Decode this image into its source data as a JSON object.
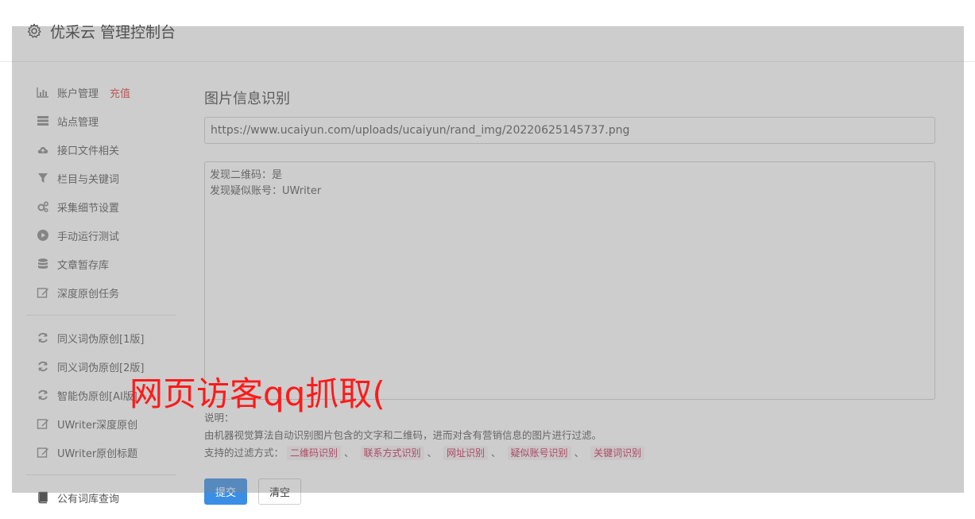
{
  "header": {
    "title": "优采云 管理控制台"
  },
  "sidebar": {
    "items": [
      {
        "label": "账户管理",
        "extra": "充值",
        "icon": "bar-chart-icon"
      },
      {
        "label": "站点管理",
        "icon": "server-icon"
      },
      {
        "label": "接口文件相关",
        "icon": "cloud-upload-icon"
      },
      {
        "label": "栏目与关键词",
        "icon": "filter-icon"
      },
      {
        "label": "采集细节设置",
        "icon": "gears-icon"
      },
      {
        "label": "手动运行测试",
        "icon": "play-circle-icon"
      },
      {
        "label": "文章暂存库",
        "icon": "database-icon"
      },
      {
        "label": "深度原创任务",
        "icon": "edit-icon"
      },
      {
        "label": "同义词伪原创[1版]",
        "icon": "refresh-icon"
      },
      {
        "label": "同义词伪原创[2版]",
        "icon": "refresh-icon"
      },
      {
        "label": "智能伪原创[AI版]",
        "icon": "refresh-icon"
      },
      {
        "label": "UWriter深度原创",
        "icon": "edit-icon"
      },
      {
        "label": "UWriter原创标题",
        "icon": "edit-icon"
      },
      {
        "label": "公有词库查询",
        "icon": "book-icon"
      }
    ]
  },
  "main": {
    "section_title": "图片信息识别",
    "url_value": "https://www.ucaiyun.com/uploads/ucaiyun/rand_img/20220625145737.png",
    "result_lines": [
      "发现二维码：是",
      "发现疑似账号：UWriter"
    ],
    "notes_heading": "说明：",
    "notes_desc": "由机器视觉算法自动识别图片包含的文字和二维码，进而对含有营销信息的图片进行过滤。",
    "filter_label": "支持的过滤方式：",
    "filter_tags": [
      "二维码识别",
      "联系方式识别",
      "网址识别",
      "疑似账号识别",
      "关键词识别"
    ],
    "separator": "、",
    "submit_label": "提交",
    "clear_label": "清空"
  },
  "overlay": {
    "text": "网页访客qq抓取("
  },
  "colors": {
    "accent": "#3a8ee6",
    "recharge": "#e03c3c",
    "tag_text": "#c7254e",
    "tag_bg": "#f9f2f4",
    "overlay_text": "#ff1a1a"
  }
}
